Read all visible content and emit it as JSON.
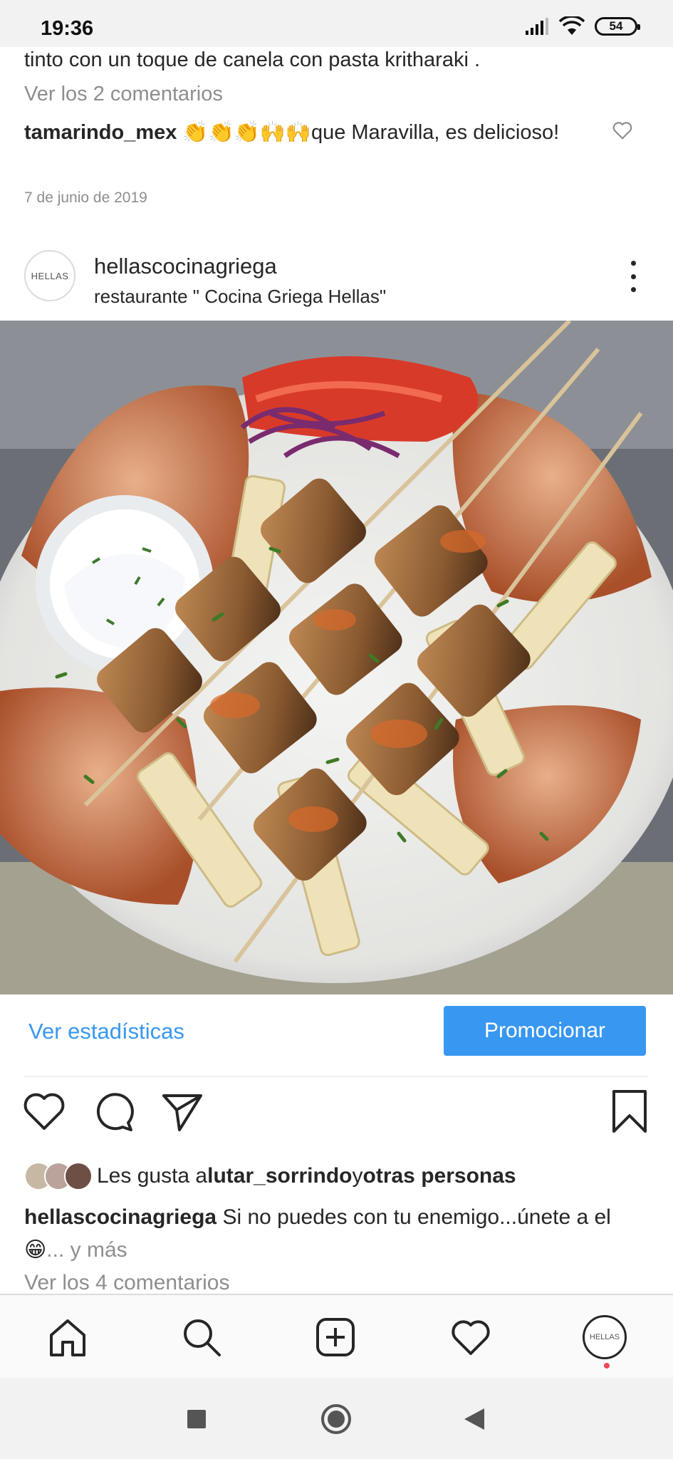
{
  "status_bar": {
    "time": "19:36",
    "battery": "54"
  },
  "previous_post": {
    "caption_tail": "tinto con un toque de canela  con pasta kritharaki .",
    "view_comments": "Ver los 2 comentarios",
    "comment": {
      "user": "tamarindo_mex",
      "text": " 👏👏👏🙌🙌que Maravilla,  es delicioso!"
    },
    "date": "7 de junio de 2019"
  },
  "post": {
    "avatar_text": "HELLAS",
    "username": "hellascocinagriega",
    "location": "restaurante \" Cocina Griega Hellas\"",
    "image_alt": "Plato de brochetas de pollo con pan pita, tzatziki, tomate, cebolla y patatas",
    "insights_label": "Ver estadísticas",
    "promote_label": "Promocionar",
    "likes": {
      "prefix": "Les gusta a ",
      "user": "lutar_sorrindo",
      "joiner": " y ",
      "others": "otras personas"
    },
    "caption": {
      "user": "hellascocinagriega",
      "text": " Si no puedes con tu enemigo...únete a el 😁",
      "more": "... y más"
    },
    "view_comments": "Ver los 4 comentarios"
  },
  "colors": {
    "accent": "#3897f0",
    "muted": "#8e8e8e",
    "text": "#262626",
    "notification": "#ed4956"
  },
  "icons": {
    "actions": [
      "heart-icon",
      "comment-icon",
      "share-icon",
      "bookmark-icon"
    ],
    "bottom_nav": [
      "home-icon",
      "search-icon",
      "add-post-icon",
      "activity-heart-icon",
      "profile-avatar"
    ],
    "system_nav": [
      "recents-square-icon",
      "home-circle-icon",
      "back-triangle-icon"
    ]
  }
}
